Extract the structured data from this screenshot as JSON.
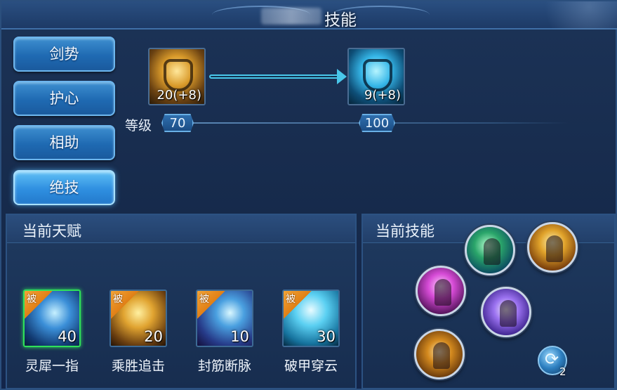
{
  "window": {
    "title": "技能"
  },
  "tabs": [
    {
      "label": "剑势"
    },
    {
      "label": "护心"
    },
    {
      "label": "相助"
    },
    {
      "label": "绝技",
      "active": true
    }
  ],
  "upgrade": {
    "current_skill": {
      "level_text": "20(+8)",
      "icon": "gold-shield-emblem-icon"
    },
    "next_skill": {
      "level_text": "9(+8)",
      "icon": "cyan-shield-emblem-icon"
    },
    "level_label": "等级",
    "current_level": "70",
    "next_level": "100"
  },
  "talents": {
    "title": "当前天赋",
    "passive_tag": "被",
    "items": [
      {
        "name": "灵犀一指",
        "count": "40",
        "icon": "lightning-finger-icon",
        "selected": true
      },
      {
        "name": "乘胜追击",
        "count": "20",
        "icon": "golden-warrior-icon"
      },
      {
        "name": "封筋断脉",
        "count": "10",
        "icon": "blade-strike-icon"
      },
      {
        "name": "破甲穿云",
        "count": "30",
        "icon": "piercing-spears-icon"
      }
    ]
  },
  "skills": {
    "title": "当前技能",
    "orbs": [
      {
        "icon": "green-sword-slash-icon"
      },
      {
        "icon": "golden-raised-arms-icon"
      },
      {
        "icon": "pink-power-figure-icon"
      },
      {
        "icon": "violet-aura-figure-icon"
      },
      {
        "icon": "amber-open-palm-icon"
      }
    ],
    "refresh": {
      "icon": "refresh-icon",
      "count": "2"
    }
  },
  "colors": {
    "panel_bg": "#162a4b",
    "tab_active": "#2f8fe0",
    "arrow": "#49c7ea",
    "passive_tag": "#e07f16",
    "selected_border": "#2fe05a"
  }
}
